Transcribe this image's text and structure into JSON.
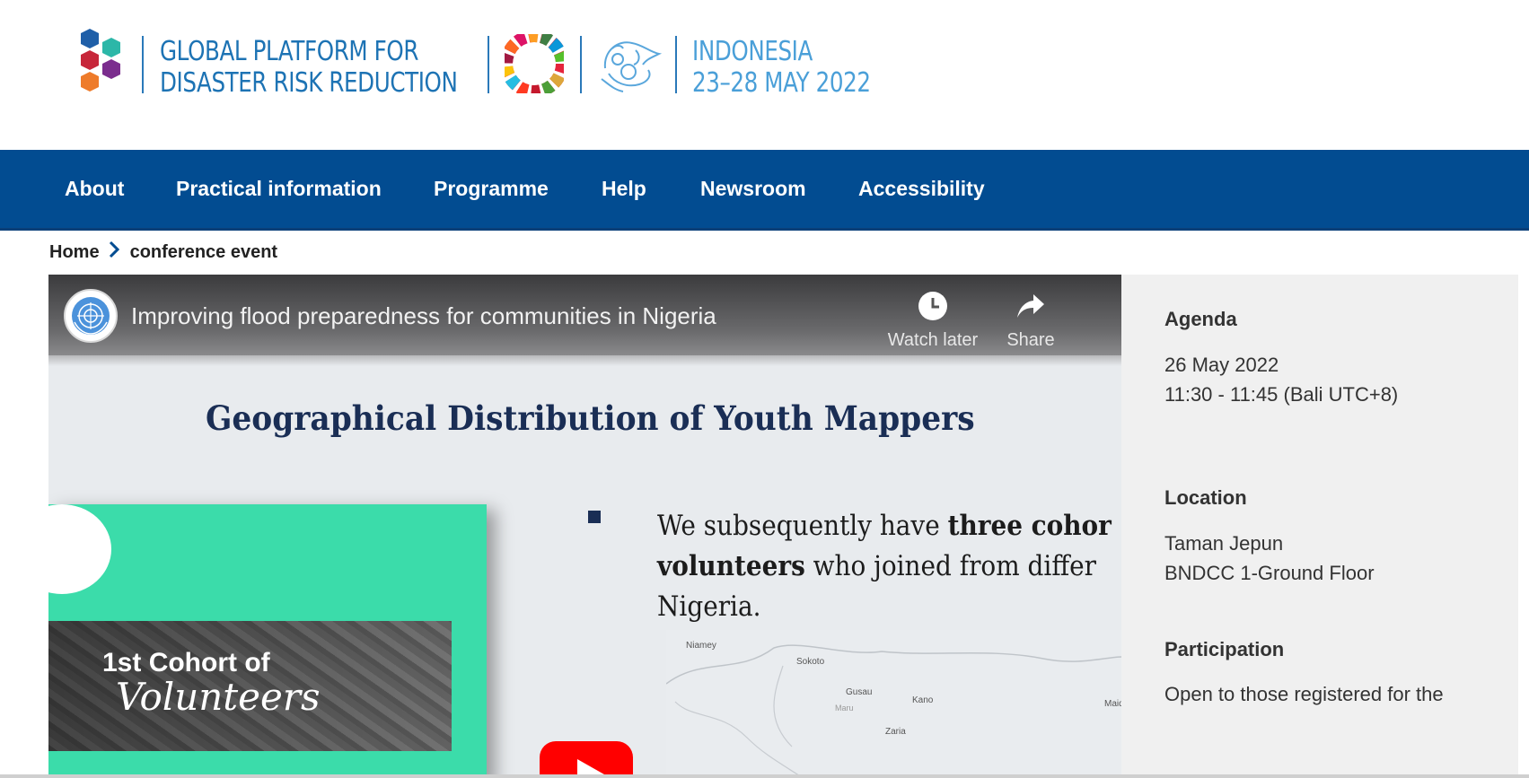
{
  "header": {
    "platform_title_line1": "GLOBAL PLATFORM FOR",
    "platform_title_line2": "DISASTER RISK REDUCTION",
    "event_location": "INDONESIA",
    "event_dates": "23–28 MAY 2022",
    "brand_color": "#1d73b4"
  },
  "nav": {
    "background": "#024c91",
    "items": [
      {
        "label": "About"
      },
      {
        "label": "Practical information"
      },
      {
        "label": "Programme"
      },
      {
        "label": "Help"
      },
      {
        "label": "Newsroom"
      },
      {
        "label": "Accessibility"
      }
    ]
  },
  "breadcrumb": {
    "home": "Home",
    "current": "conference event"
  },
  "video": {
    "title": "Improving flood preparedness for communities in Nigeria",
    "watch_later": "Watch later",
    "share": "Share",
    "channel_icon": "un-logo-icon",
    "slide": {
      "title": "Geographical Distribution of Youth Mappers",
      "text_line1_a": "We subsequently have ",
      "text_line1_b": "three cohor",
      "text_line2_a": "volunteers",
      "text_line2_b": " who joined from differ",
      "text_line3": "Nigeria.",
      "cohort_label": "1st Cohort of",
      "cohort_script": "Volunteers",
      "map_labels": [
        "Niamey",
        "Sokoto",
        "Gusau",
        "Maru",
        "Kano",
        "Zaria",
        "Maid"
      ]
    }
  },
  "sidebar": {
    "agenda_heading": "Agenda",
    "agenda_date": "26 May 2022",
    "agenda_time": "11:30 - 11:45 (Bali UTC+8)",
    "location_heading": "Location",
    "location_line1": "Taman Jepun",
    "location_line2": "BNDCC 1-Ground Floor",
    "participation_heading": "Participation",
    "participation_text": "Open to those registered for the"
  }
}
